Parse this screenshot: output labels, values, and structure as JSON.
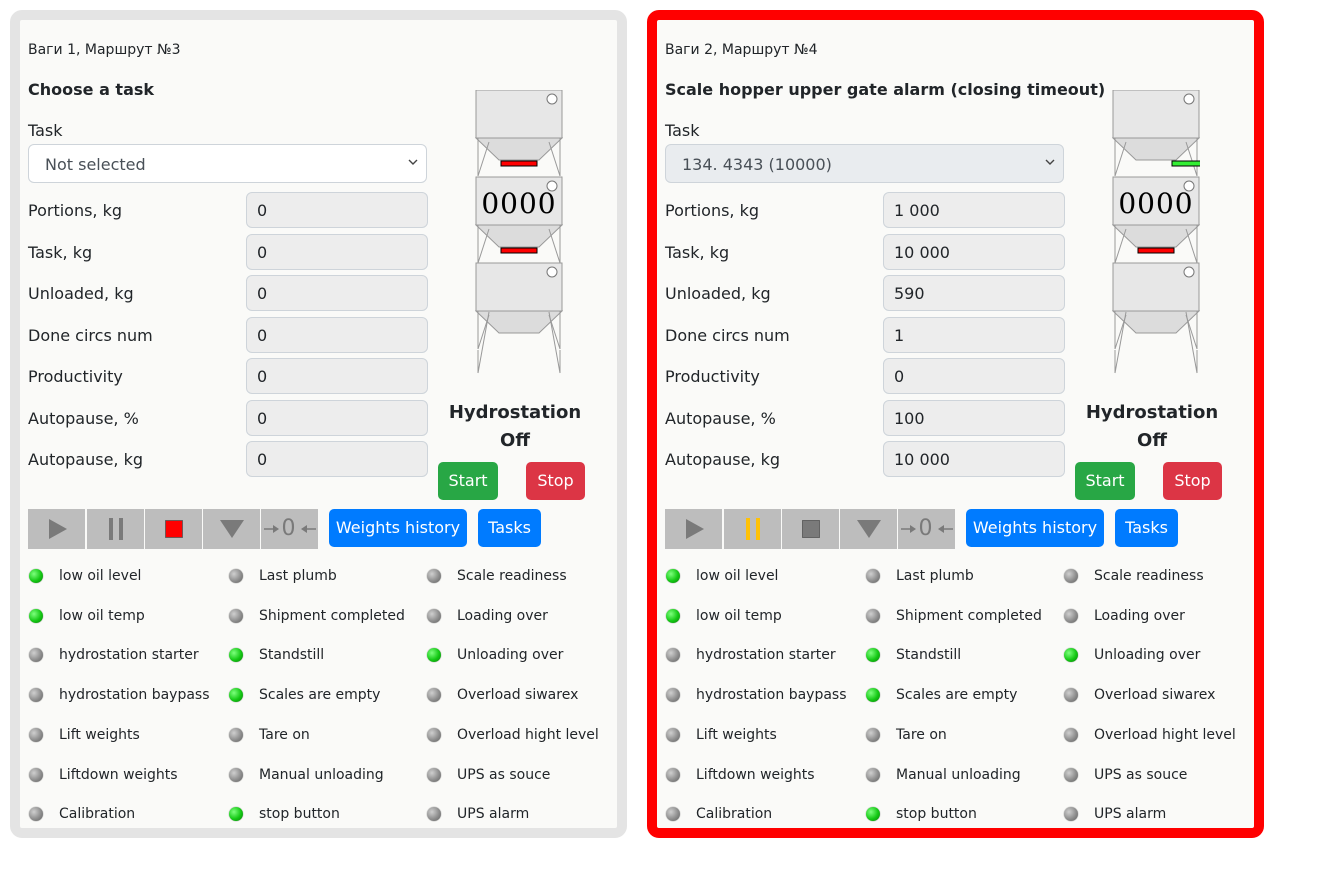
{
  "colors": {
    "active_panel_border": "#ff0000",
    "inactive_panel_border": "#e4e4e4",
    "start": "#28a745",
    "stop": "#dc3545",
    "primary": "#007bff",
    "led_on": "#14c814",
    "led_off": "#8e8e8e",
    "gate_red": "#ff0000",
    "gate_green": "#33ee33",
    "ctrl_stop_active": "#ff0000",
    "ctrl_pause_active": "#ffc107"
  },
  "panels": [
    {
      "title": "Ваги 1, Маршрут №3",
      "status_heading": "Choose a task",
      "task_label": "Task",
      "task_value": "Not selected",
      "task_disabled": false,
      "fields": [
        {
          "label": "Portions, kg",
          "value": "0"
        },
        {
          "label": "Task, kg",
          "value": "0"
        },
        {
          "label": "Unloaded, kg",
          "value": "0"
        },
        {
          "label": "Done circs num",
          "value": "0"
        },
        {
          "label": "Productivity",
          "value": "0"
        },
        {
          "label": "Autopause, %",
          "value": "0"
        },
        {
          "label": "Autopause, kg",
          "value": "0"
        }
      ],
      "hopper": {
        "display": "0000",
        "upper_gate": "closed-red",
        "lower_gate": "closed-red"
      },
      "hydrostation": {
        "title": "Hydrostation",
        "state": "Off"
      },
      "buttons": {
        "start": "Start",
        "stop": "Stop",
        "weights_history": "Weights history",
        "tasks": "Tasks"
      },
      "controls": [
        {
          "name": "play",
          "icon": "play-icon",
          "active": false
        },
        {
          "name": "pause",
          "icon": "pause-icon",
          "active": false
        },
        {
          "name": "stop",
          "icon": "stop-icon",
          "active": true
        },
        {
          "name": "unload",
          "icon": "triangle-down-icon",
          "active": false
        },
        {
          "name": "zero",
          "icon": "zero-icon",
          "active": false
        }
      ],
      "zero_glyph": "0",
      "indicators": [
        [
          {
            "label": "low oil level",
            "on": true
          },
          {
            "label": "low oil temp",
            "on": true
          },
          {
            "label": "hydrostation starter",
            "on": false
          },
          {
            "label": "hydrostation baypass",
            "on": false
          },
          {
            "label": "Lift weights",
            "on": false
          },
          {
            "label": "Liftdown weights",
            "on": false
          },
          {
            "label": "Calibration",
            "on": false
          }
        ],
        [
          {
            "label": "Last plumb",
            "on": false
          },
          {
            "label": "Shipment completed",
            "on": false
          },
          {
            "label": "Standstill",
            "on": true
          },
          {
            "label": "Scales are empty",
            "on": true
          },
          {
            "label": "Tare on",
            "on": false
          },
          {
            "label": "Manual unloading",
            "on": false
          },
          {
            "label": "stop button",
            "on": true
          }
        ],
        [
          {
            "label": "Scale readiness",
            "on": false
          },
          {
            "label": "Loading over",
            "on": false
          },
          {
            "label": "Unloading over",
            "on": true
          },
          {
            "label": "Overload siwarex",
            "on": false
          },
          {
            "label": "Overload hight level",
            "on": false
          },
          {
            "label": "UPS as souce",
            "on": false
          },
          {
            "label": "UPS alarm",
            "on": false
          }
        ]
      ]
    },
    {
      "title": "Ваги 2, Маршрут №4",
      "status_heading": "Scale hopper upper gate alarm (closing timeout)",
      "task_label": "Task",
      "task_value": "134. 4343 (10000)",
      "task_disabled": true,
      "fields": [
        {
          "label": "Portions, kg",
          "value": "1 000"
        },
        {
          "label": "Task, kg",
          "value": "10 000"
        },
        {
          "label": "Unloaded, kg",
          "value": "590"
        },
        {
          "label": "Done circs num",
          "value": "1"
        },
        {
          "label": "Productivity",
          "value": "0"
        },
        {
          "label": "Autopause, %",
          "value": "100"
        },
        {
          "label": "Autopause, kg",
          "value": "10 000"
        }
      ],
      "hopper": {
        "display": "0000",
        "upper_gate": "open-green",
        "lower_gate": "closed-red"
      },
      "hydrostation": {
        "title": "Hydrostation",
        "state": "Off"
      },
      "buttons": {
        "start": "Start",
        "stop": "Stop",
        "weights_history": "Weights history",
        "tasks": "Tasks"
      },
      "controls": [
        {
          "name": "play",
          "icon": "play-icon",
          "active": false
        },
        {
          "name": "pause",
          "icon": "pause-icon",
          "active": true
        },
        {
          "name": "stop",
          "icon": "stop-icon",
          "active": false
        },
        {
          "name": "unload",
          "icon": "triangle-down-icon",
          "active": false
        },
        {
          "name": "zero",
          "icon": "zero-icon",
          "active": false
        }
      ],
      "zero_glyph": "0",
      "indicators": [
        [
          {
            "label": "low oil level",
            "on": true
          },
          {
            "label": "low oil temp",
            "on": true
          },
          {
            "label": "hydrostation starter",
            "on": false
          },
          {
            "label": "hydrostation baypass",
            "on": false
          },
          {
            "label": "Lift weights",
            "on": false
          },
          {
            "label": "Liftdown weights",
            "on": false
          },
          {
            "label": "Calibration",
            "on": false
          }
        ],
        [
          {
            "label": "Last plumb",
            "on": false
          },
          {
            "label": "Shipment completed",
            "on": false
          },
          {
            "label": "Standstill",
            "on": true
          },
          {
            "label": "Scales are empty",
            "on": true
          },
          {
            "label": "Tare on",
            "on": false
          },
          {
            "label": "Manual unloading",
            "on": false
          },
          {
            "label": "stop button",
            "on": true
          }
        ],
        [
          {
            "label": "Scale readiness",
            "on": false
          },
          {
            "label": "Loading over",
            "on": false
          },
          {
            "label": "Unloading over",
            "on": true
          },
          {
            "label": "Overload siwarex",
            "on": false
          },
          {
            "label": "Overload hight level",
            "on": false
          },
          {
            "label": "UPS as souce",
            "on": false
          },
          {
            "label": "UPS alarm",
            "on": false
          }
        ]
      ]
    }
  ]
}
